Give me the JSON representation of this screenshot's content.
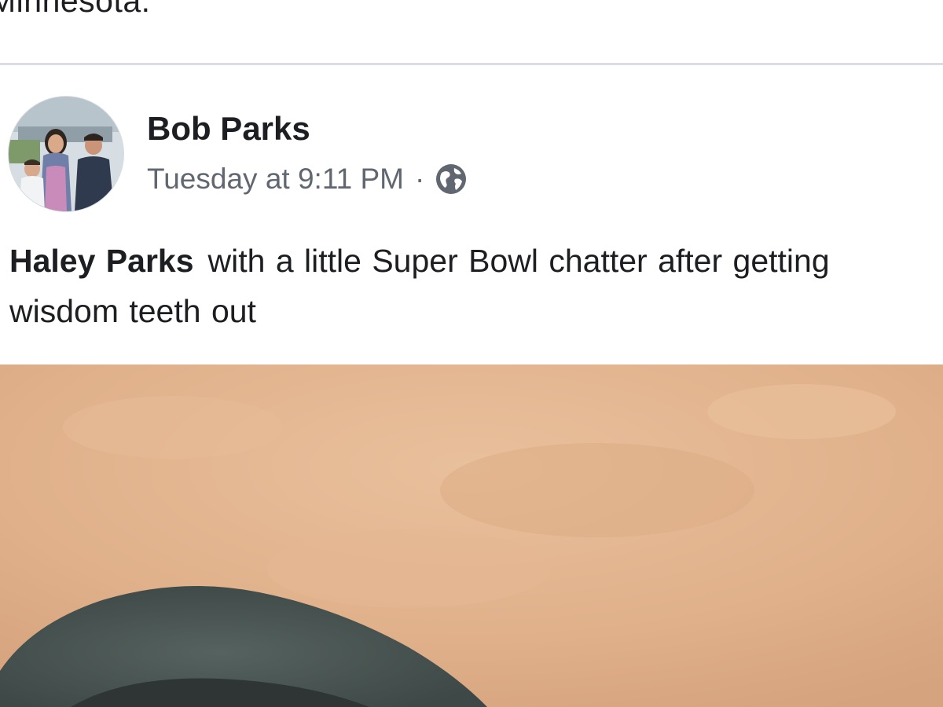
{
  "previous_post": {
    "text_fragment": "Minnesota."
  },
  "post": {
    "author_name": "Bob Parks",
    "timestamp": "Tuesday at 9:11 PM",
    "separator": "·",
    "audience_icon": "globe-icon",
    "mention_name": "Haley Parks",
    "body_text": "with a little Super Bowl chatter after getting wisdom teeth out",
    "avatar_description_icon": "profile-photo",
    "photo_icon": "video-thumbnail"
  },
  "colors": {
    "text_primary": "#1c1e21",
    "text_secondary": "#606770",
    "divider": "#dadde1",
    "photo_wall": "#e2b48f",
    "hat": "#4d5a58"
  }
}
